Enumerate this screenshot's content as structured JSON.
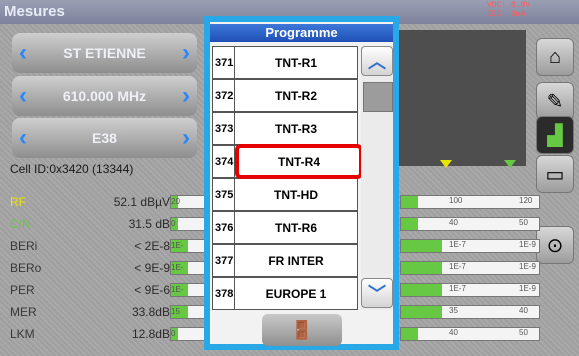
{
  "app": {
    "title": "Mesures",
    "vdc": "VDC: 0.0V",
    "idc": "IDC: 0mA"
  },
  "nav": [
    {
      "value": "ST ETIENNE"
    },
    {
      "value": "610.000 MHz"
    },
    {
      "value": "E38"
    }
  ],
  "cell_id": "Cell ID:0x3420 (13344)",
  "measures": [
    {
      "label": "RF",
      "value": "52.1 dBµV",
      "scale_left": "20",
      "scale_right": [
        "100",
        "120"
      ],
      "fill": 0.12,
      "label_color": "#f2e600"
    },
    {
      "label": "C/N",
      "value": "31.5 dB",
      "scale_left": "0",
      "scale_right": [
        "40",
        "50"
      ],
      "fill": 0.12,
      "label_color": "#66c843"
    },
    {
      "label": "BERi",
      "value": "< 2E-8",
      "scale_left": "1E-",
      "scale_right": [
        "1E-7",
        "1E-9"
      ],
      "fill": 0.3,
      "label_color": "#383838"
    },
    {
      "label": "BERo",
      "value": "< 9E-9",
      "scale_left": "1E-",
      "scale_right": [
        "1E-7",
        "1E-9"
      ],
      "fill": 0.3,
      "label_color": "#383838"
    },
    {
      "label": "PER",
      "value": "< 9E-6",
      "scale_left": "1E-",
      "scale_right": [
        "1E-7",
        "1E-9"
      ],
      "fill": 0.3,
      "label_color": "#383838"
    },
    {
      "label": "MER",
      "value": "33.8dB",
      "scale_left": "15",
      "scale_right": [
        "35",
        "40"
      ],
      "fill": 0.3,
      "label_color": "#383838"
    },
    {
      "label": "LKM",
      "value": "12.8dB",
      "scale_left": "0",
      "scale_right": [
        "40",
        "50"
      ],
      "fill": 0.12,
      "label_color": "#383838"
    }
  ],
  "side_icons": [
    "home-icon",
    "pencil-icon",
    "spectrum-icon",
    "monitor-icon",
    "satellite-icon"
  ],
  "dialog": {
    "title": "Programme",
    "programs": [
      {
        "num": "371",
        "name": "TNT-R1"
      },
      {
        "num": "372",
        "name": "TNT-R2"
      },
      {
        "num": "373",
        "name": "TNT-R3"
      },
      {
        "num": "374",
        "name": "TNT-R4"
      },
      {
        "num": "375",
        "name": "TNT-HD"
      },
      {
        "num": "376",
        "name": "TNT-R6"
      },
      {
        "num": "377",
        "name": "FR INTER"
      },
      {
        "num": "378",
        "name": "EUROPE 1"
      }
    ],
    "selected_index": 3
  },
  "colors": {
    "dialog_border": "#29a8e8",
    "selection": "#e60000",
    "accent": "#2a86ff"
  }
}
